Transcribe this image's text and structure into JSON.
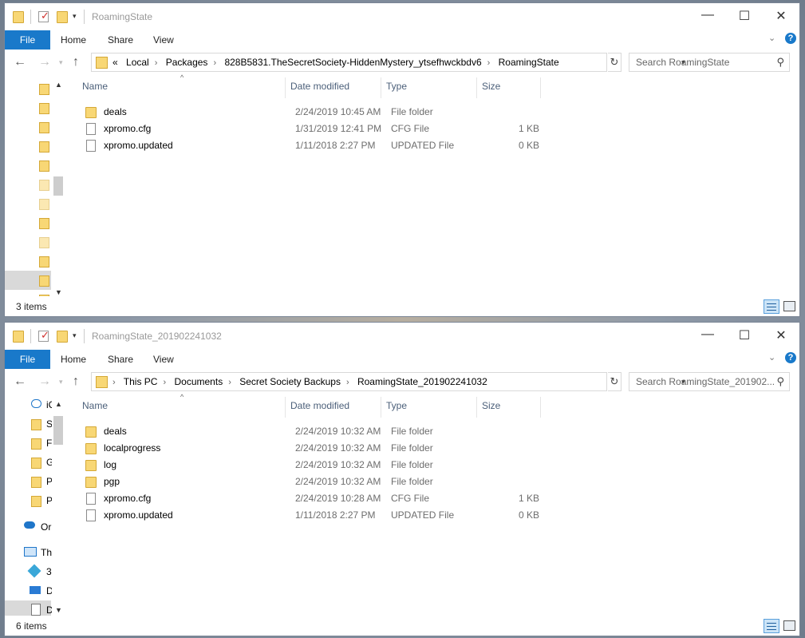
{
  "windows": [
    {
      "title": "RoamingState",
      "ribbon": {
        "file": "File",
        "home": "Home",
        "share": "Share",
        "view": "View"
      },
      "breadcrumbs": [
        "«",
        "Local",
        "Packages",
        "828B5831.TheSecretSociety-HiddenMystery_ytsefhwckbdv6",
        "RoamingState"
      ],
      "search_placeholder": "Search RoamingState",
      "columns": {
        "name": "Name",
        "date": "Date modified",
        "type": "Type",
        "size": "Size"
      },
      "files": [
        {
          "name": "deals",
          "date": "2/24/2019 10:45 AM",
          "type": "File folder",
          "size": "",
          "icon": "folder-icon"
        },
        {
          "name": "xpromo.cfg",
          "date": "1/31/2019 12:41 PM",
          "type": "CFG File",
          "size": "1 KB",
          "icon": "file-icon"
        },
        {
          "name": "xpromo.updated",
          "date": "1/11/2018 2:27 PM",
          "type": "UPDATED File",
          "size": "0 KB",
          "icon": "file-icon"
        }
      ],
      "status": "3 items"
    },
    {
      "title": "RoamingState_201902241032",
      "ribbon": {
        "file": "File",
        "home": "Home",
        "share": "Share",
        "view": "View"
      },
      "breadcrumbs": [
        "This PC",
        "Documents",
        "Secret Society Backups",
        "RoamingState_201902241032"
      ],
      "search_placeholder": "Search RoamingState_201902...",
      "columns": {
        "name": "Name",
        "date": "Date modified",
        "type": "Type",
        "size": "Size"
      },
      "files": [
        {
          "name": "deals",
          "date": "2/24/2019 10:32 AM",
          "type": "File folder",
          "size": "",
          "icon": "folder-icon"
        },
        {
          "name": "localprogress",
          "date": "2/24/2019 10:32 AM",
          "type": "File folder",
          "size": "",
          "icon": "folder-icon"
        },
        {
          "name": "log",
          "date": "2/24/2019 10:32 AM",
          "type": "File folder",
          "size": "",
          "icon": "folder-icon"
        },
        {
          "name": "pgp",
          "date": "2/24/2019 10:32 AM",
          "type": "File folder",
          "size": "",
          "icon": "folder-icon"
        },
        {
          "name": "xpromo.cfg",
          "date": "2/24/2019 10:28 AM",
          "type": "CFG File",
          "size": "1 KB",
          "icon": "file-icon"
        },
        {
          "name": "xpromo.updated",
          "date": "1/11/2018 2:27 PM",
          "type": "UPDATED File",
          "size": "0 KB",
          "icon": "file-icon"
        }
      ],
      "nav_labels": [
        "iC",
        "S",
        "F",
        "G",
        "P",
        "P",
        "Or",
        "Th",
        "3",
        "D",
        "D"
      ],
      "status": "6 items"
    }
  ],
  "colors": {
    "accent": "#1979ca",
    "folder": "#f8d775",
    "header_text": "#4c607a"
  }
}
